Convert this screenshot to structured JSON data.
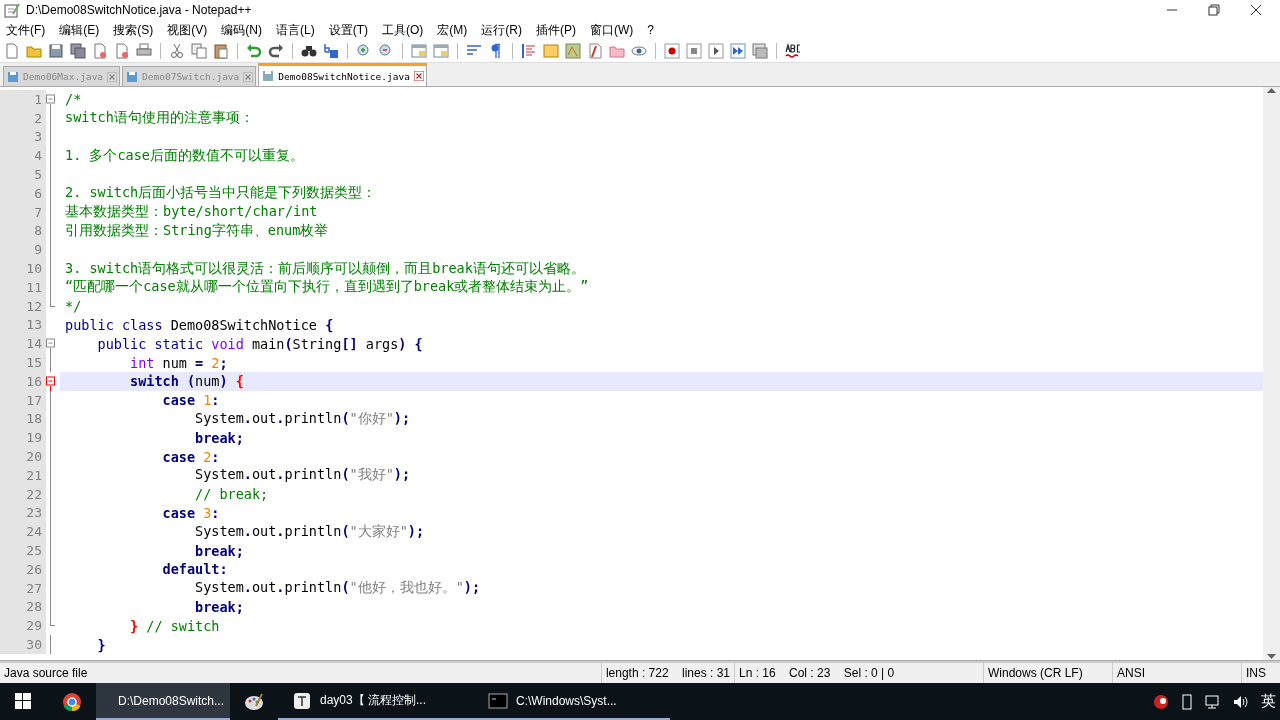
{
  "window": {
    "title": "D:\\Demo08SwitchNotice.java - Notepad++"
  },
  "menu": [
    "文件(F)",
    "编辑(E)",
    "搜索(S)",
    "视图(V)",
    "编码(N)",
    "语言(L)",
    "设置(T)",
    "工具(O)",
    "宏(M)",
    "运行(R)",
    "插件(P)",
    "窗口(W)",
    "?"
  ],
  "tabs": [
    {
      "label": "Demo06Max.java",
      "selected": false
    },
    {
      "label": "Demo07Switch.java",
      "selected": false
    },
    {
      "label": "Demo08SwitchNotice.java",
      "selected": true
    }
  ],
  "editor": {
    "lines": [
      {
        "number": "1",
        "kind": "fold_start",
        "current": false,
        "tokens": [
          {
            "kind": "comment",
            "text": "/*"
          }
        ]
      },
      {
        "number": "2",
        "kind": "fold_body",
        "current": false,
        "tokens": [
          {
            "kind": "comment",
            "text": "switch语句使用的注意事项："
          }
        ]
      },
      {
        "number": "3",
        "kind": "fold_body",
        "current": false
      },
      {
        "number": "4",
        "kind": "fold_body",
        "current": false,
        "tokens": [
          {
            "kind": "comment",
            "text": "1. 多个case后面的数值不可以重复。"
          }
        ]
      },
      {
        "number": "5",
        "kind": "fold_body",
        "current": false
      },
      {
        "number": "6",
        "kind": "fold_body",
        "current": false,
        "tokens": [
          {
            "kind": "comment",
            "text": "2. switch后面小括号当中只能是下列数据类型："
          }
        ]
      },
      {
        "number": "7",
        "kind": "fold_body",
        "current": false,
        "tokens": [
          {
            "kind": "comment",
            "text": "基本数据类型：byte/short/char/int"
          }
        ]
      },
      {
        "number": "8",
        "kind": "fold_body",
        "current": false,
        "tokens": [
          {
            "kind": "comment",
            "text": "引用数据类型：String字符串、enum枚举"
          }
        ]
      },
      {
        "number": "9",
        "kind": "fold_body",
        "current": false
      },
      {
        "number": "10",
        "kind": "fold_body",
        "current": false,
        "tokens": [
          {
            "kind": "comment",
            "text": "3. switch语句格式可以很灵活：前后顺序可以颠倒，而且break语句还可以省略。"
          }
        ]
      },
      {
        "number": "11",
        "kind": "fold_body",
        "current": false,
        "tokens": [
          {
            "kind": "comment",
            "text": "“匹配哪一个case就从哪一个位置向下执行，直到遇到了break或者整体结束为止。”"
          }
        ]
      },
      {
        "number": "12",
        "kind": "fold_end",
        "current": false,
        "tokens": [
          {
            "kind": "comment",
            "text": "*/"
          }
        ]
      },
      {
        "number": "13",
        "kind": "plain",
        "current": false,
        "tokens": [
          {
            "kind": "keyword",
            "text": "public"
          },
          {
            "kind": "keyword",
            "text": " class"
          },
          {
            "kind": "plain",
            "text": " Demo08SwitchNotice"
          },
          {
            "kind": "op",
            "text": " {"
          }
        ]
      },
      {
        "number": "14",
        "kind": "fold_start",
        "current": false,
        "tokens": [
          {
            "kind": "keyword",
            "text": "    public"
          },
          {
            "kind": "keyword",
            "text": " static"
          },
          {
            "kind": "type",
            "text": " void"
          },
          {
            "kind": "plain",
            "text": " main"
          },
          {
            "kind": "op",
            "text": "("
          },
          {
            "kind": "plain",
            "text": "String"
          },
          {
            "kind": "op",
            "text": "[]"
          },
          {
            "kind": "plain",
            "text": " args"
          },
          {
            "kind": "op",
            "text": ")"
          },
          {
            "kind": "op",
            "text": " {"
          }
        ]
      },
      {
        "number": "15",
        "kind": "fold_body",
        "current": false,
        "tokens": [
          {
            "kind": "type",
            "text": "        int"
          },
          {
            "kind": "plain",
            "text": " num"
          },
          {
            "kind": "op",
            "text": " ="
          },
          {
            "kind": "number",
            "text": " 2"
          },
          {
            "kind": "op",
            "text": ";"
          }
        ]
      },
      {
        "number": "16",
        "kind": "fold_start",
        "current": true,
        "tokens": [
          {
            "kind": "instr",
            "text": "        switch"
          },
          {
            "kind": "op",
            "text": " ("
          },
          {
            "kind": "plain",
            "text": "num"
          },
          {
            "kind": "op",
            "text": ")"
          },
          {
            "kind": "brace",
            "text": " {"
          }
        ]
      },
      {
        "number": "17",
        "kind": "fold_body",
        "current": false,
        "tokens": [
          {
            "kind": "instr",
            "text": "            case"
          },
          {
            "kind": "number",
            "text": " 1"
          },
          {
            "kind": "op",
            "text": ":"
          }
        ]
      },
      {
        "number": "18",
        "kind": "fold_body",
        "current": false,
        "tokens": [
          {
            "kind": "plain",
            "text": "                System"
          },
          {
            "kind": "op",
            "text": "."
          },
          {
            "kind": "plain",
            "text": "out"
          },
          {
            "kind": "op",
            "text": "."
          },
          {
            "kind": "plain",
            "text": "println"
          },
          {
            "kind": "op",
            "text": "("
          },
          {
            "kind": "string",
            "text": "\"你好\""
          },
          {
            "kind": "op",
            "text": ");"
          }
        ]
      },
      {
        "number": "19",
        "kind": "fold_body",
        "current": false,
        "tokens": [
          {
            "kind": "instr",
            "text": "                break"
          },
          {
            "kind": "op",
            "text": ";"
          }
        ]
      },
      {
        "number": "20",
        "kind": "fold_body",
        "current": false,
        "tokens": [
          {
            "kind": "instr",
            "text": "            case"
          },
          {
            "kind": "number",
            "text": " 2"
          },
          {
            "kind": "op",
            "text": ":"
          }
        ]
      },
      {
        "number": "21",
        "kind": "fold_body",
        "current": false,
        "tokens": [
          {
            "kind": "plain",
            "text": "                System"
          },
          {
            "kind": "op",
            "text": "."
          },
          {
            "kind": "plain",
            "text": "out"
          },
          {
            "kind": "op",
            "text": "."
          },
          {
            "kind": "plain",
            "text": "println"
          },
          {
            "kind": "op",
            "text": "("
          },
          {
            "kind": "string",
            "text": "\"我好\""
          },
          {
            "kind": "op",
            "text": ");"
          }
        ]
      },
      {
        "number": "22",
        "kind": "fold_body",
        "current": false,
        "tokens": [
          {
            "kind": "comment",
            "text": "                // break;"
          }
        ]
      },
      {
        "number": "23",
        "kind": "fold_body",
        "current": false,
        "tokens": [
          {
            "kind": "instr",
            "text": "            case"
          },
          {
            "kind": "number",
            "text": " 3"
          },
          {
            "kind": "op",
            "text": ":"
          }
        ]
      },
      {
        "number": "24",
        "kind": "fold_body",
        "current": false,
        "tokens": [
          {
            "kind": "plain",
            "text": "                System"
          },
          {
            "kind": "op",
            "text": "."
          },
          {
            "kind": "plain",
            "text": "out"
          },
          {
            "kind": "op",
            "text": "."
          },
          {
            "kind": "plain",
            "text": "println"
          },
          {
            "kind": "op",
            "text": "("
          },
          {
            "kind": "string",
            "text": "\"大家好\""
          },
          {
            "kind": "op",
            "text": ");"
          }
        ]
      },
      {
        "number": "25",
        "kind": "fold_body",
        "current": false,
        "tokens": [
          {
            "kind": "instr",
            "text": "                break"
          },
          {
            "kind": "op",
            "text": ";"
          }
        ]
      },
      {
        "number": "26",
        "kind": "fold_body",
        "current": false,
        "tokens": [
          {
            "kind": "instr",
            "text": "            default"
          },
          {
            "kind": "op",
            "text": ":"
          }
        ]
      },
      {
        "number": "27",
        "kind": "fold_body",
        "current": false,
        "tokens": [
          {
            "kind": "plain",
            "text": "                System"
          },
          {
            "kind": "op",
            "text": "."
          },
          {
            "kind": "plain",
            "text": "out"
          },
          {
            "kind": "op",
            "text": "."
          },
          {
            "kind": "plain",
            "text": "println"
          },
          {
            "kind": "op",
            "text": "("
          },
          {
            "kind": "string",
            "text": "\"他好，我也好。\""
          },
          {
            "kind": "op",
            "text": ");"
          }
        ]
      },
      {
        "number": "28",
        "kind": "fold_body",
        "current": false,
        "tokens": [
          {
            "kind": "instr",
            "text": "                break"
          },
          {
            "kind": "op",
            "text": ";"
          }
        ]
      },
      {
        "number": "29",
        "kind": "fold_end",
        "current": false,
        "tokens": [
          {
            "kind": "brace",
            "text": "        }"
          },
          {
            "kind": "comment",
            "text": " // switch"
          }
        ]
      },
      {
        "number": "30",
        "kind": "fold_body",
        "current": false,
        "tokens": [
          {
            "kind": "op",
            "text": "    }"
          }
        ]
      }
    ]
  },
  "status_bar": {
    "file_type": "Java source file",
    "fields": [
      "length : 722    lines : 31",
      "Ln : 16    Col : 23    Sel : 0 | 0",
      "Windows (CR LF)",
      "ANSI",
      "INS"
    ]
  },
  "taskbar": {
    "apps": [
      {
        "kind": "start",
        "active": false
      },
      {
        "kind": "browser",
        "active": false
      },
      {
        "kind": "editor",
        "label": "D:\\Demo08Switch...",
        "active": true
      },
      {
        "kind": "paint",
        "active": false
      },
      {
        "kind": "writer",
        "label": "day03【 流程控制...",
        "active": false
      },
      {
        "kind": "console",
        "label": "C:\\Windows\\Syst...",
        "active": false
      }
    ],
    "input_method": "英"
  }
}
